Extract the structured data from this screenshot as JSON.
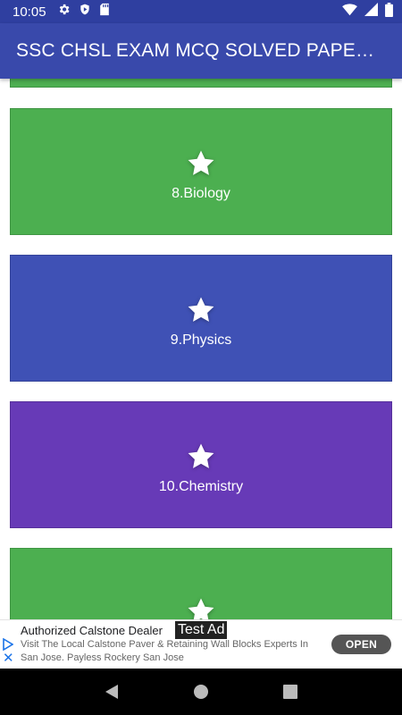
{
  "status_bar": {
    "time": "10:05",
    "left_icons": [
      "gear-icon",
      "shield-icon",
      "sd-card-icon"
    ],
    "right_icons": [
      "wifi-icon",
      "signal-icon",
      "battery-icon"
    ]
  },
  "app_bar": {
    "title": "SSC CHSL EXAM MCQ SOLVED PAPER…"
  },
  "cards": [
    {
      "label": "",
      "color": "#4caf50",
      "icon": "star-icon"
    },
    {
      "label": "8.Biology",
      "color": "#4caf50",
      "icon": "star-icon"
    },
    {
      "label": "9.Physics",
      "color": "#3f51b5",
      "icon": "star-icon"
    },
    {
      "label": "10.Chemistry",
      "color": "#673ab7",
      "icon": "star-icon"
    },
    {
      "label": "",
      "color": "#4caf50",
      "icon": "star-icon"
    }
  ],
  "ad": {
    "title": "Authorized Calstone Dealer",
    "test_label": "Test Ad",
    "description": "Visit The Local Calstone Paver & Retaining Wall Blocks Experts In San Jose. Payless Rockery San Jose",
    "button_label": "OPEN",
    "icons": [
      "adchoices-icon",
      "close-icon"
    ]
  },
  "nav_bar": {
    "buttons": [
      "back-icon",
      "home-icon",
      "recents-icon"
    ]
  },
  "colors": {
    "status_bar": "#2f3fa0",
    "app_bar": "#3949ab",
    "green": "#4caf50",
    "indigo": "#3f51b5",
    "purple": "#673ab7"
  }
}
